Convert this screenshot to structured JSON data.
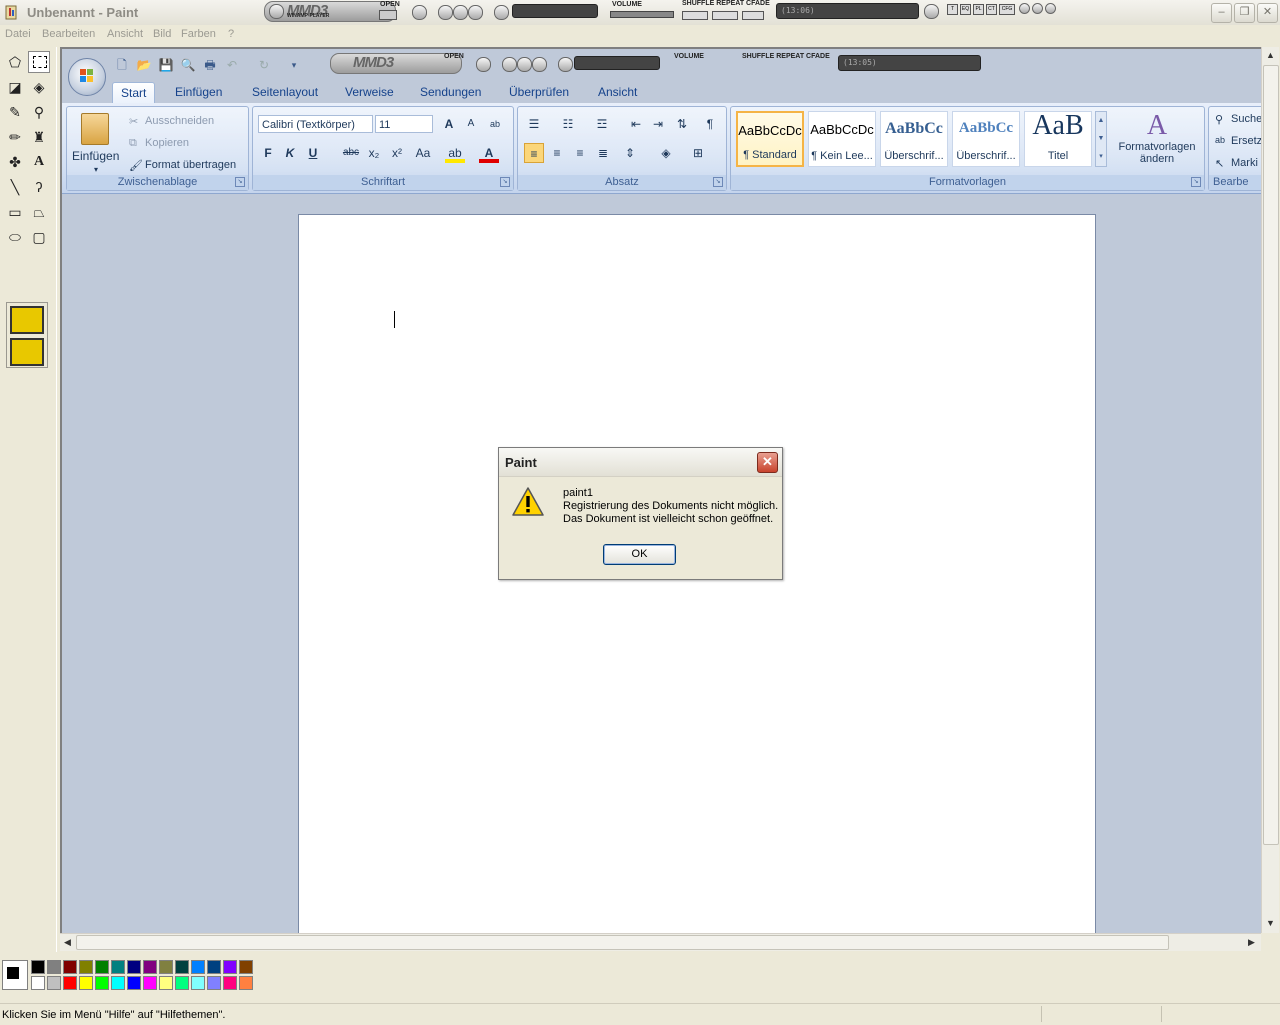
{
  "window": {
    "title": "Unbenannt - Paint",
    "minimize": "–",
    "maximize": "❐",
    "close": "✕"
  },
  "menu": [
    "Datei",
    "Bearbeiten",
    "Ansicht",
    "Bild",
    "Farben",
    "?"
  ],
  "winamp": {
    "logo": "MMD3",
    "sublogo": "WINAMP-PLAYER",
    "open_label": "OPEN",
    "volume_label": "VOLUME",
    "modes_label": "SHUFFLE REPEAT CFADE",
    "time_display": "(13:06)",
    "time_display_2": "(13:05)",
    "buttons": [
      "T",
      "EQ",
      "PL",
      "CT",
      "CFG"
    ]
  },
  "word": {
    "tabs": [
      "Start",
      "Einfügen",
      "Seitenlayout",
      "Verweise",
      "Sendungen",
      "Überprüfen",
      "Ansicht"
    ],
    "clipboard": {
      "paste": "Einfügen",
      "cut": "Ausschneiden",
      "copy": "Kopieren",
      "format_painter": "Format übertragen",
      "group": "Zwischenablage"
    },
    "font": {
      "name": "Calibri (Textkörper)",
      "size": "11",
      "group": "Schriftart",
      "bold": "F",
      "italic": "K",
      "underline": "U",
      "strike": "abc",
      "sub": "x₂",
      "sup": "x²",
      "case": "Aa",
      "grow": "A",
      "shrink": "A"
    },
    "paragraph": {
      "group": "Absatz"
    },
    "styles": {
      "group": "Formatvorlagen",
      "items": [
        {
          "preview": "AaBbCcDc",
          "name": "¶ Standard"
        },
        {
          "preview": "AaBbCcDc",
          "name": "¶ Kein Lee..."
        },
        {
          "preview": "AaBbCc",
          "name": "Überschrif..."
        },
        {
          "preview": "AaBbCc",
          "name": "Überschrif..."
        },
        {
          "preview": "AaB",
          "name": "Titel"
        }
      ],
      "change_label_1": "Formatvorlagen",
      "change_label_2": "ändern"
    },
    "editing": {
      "find": "Suche",
      "replace": "Ersetz",
      "select": "Marki",
      "group": "Bearbe"
    }
  },
  "dialog": {
    "title": "Paint",
    "line1": "paint1",
    "line2": "Registrierung des Dokuments nicht möglich.",
    "line3": "Das Dokument ist vielleicht schon geöffnet.",
    "ok": "OK"
  },
  "palette": {
    "top": [
      "#000000",
      "#808080",
      "#800000",
      "#808000",
      "#008000",
      "#008080",
      "#000080",
      "#800080",
      "#808040",
      "#004040",
      "#0080ff",
      "#004080",
      "#8000ff",
      "#804000"
    ],
    "bottom": [
      "#ffffff",
      "#c0c0c0",
      "#ff0000",
      "#ffff00",
      "#00ff00",
      "#00ffff",
      "#0000ff",
      "#ff00ff",
      "#ffff80",
      "#00ff80",
      "#80ffff",
      "#8080ff",
      "#ff0080",
      "#ff8040"
    ]
  },
  "status": "Klicken Sie im Menü \"Hilfe\" auf \"Hilfethemen\"."
}
